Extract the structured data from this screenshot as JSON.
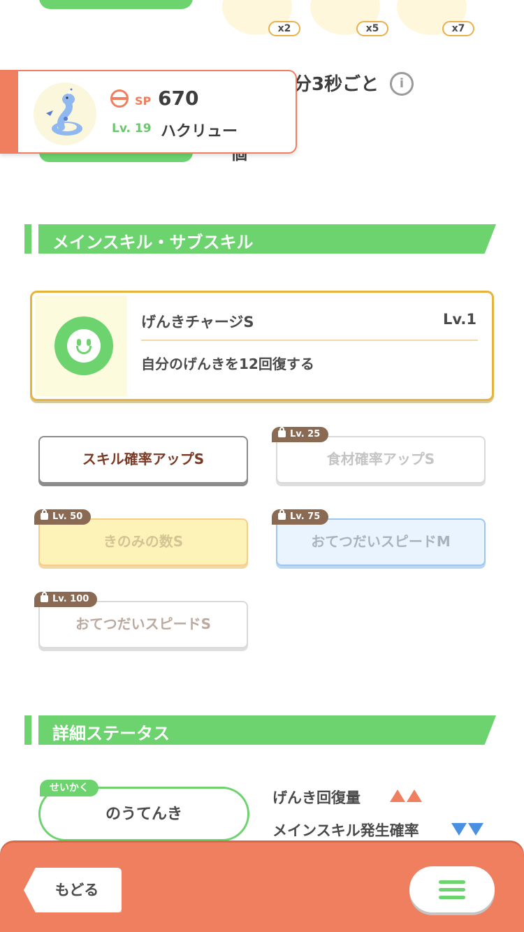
{
  "top": {
    "quantities": [
      "x2",
      "x5",
      "x7"
    ],
    "interval_text": "分3秒ごと",
    "partial_text": "個"
  },
  "pokemon": {
    "sp_label": "SP",
    "sp_value": "670",
    "level": "Lv. 19",
    "name": "ハクリュー"
  },
  "skills_section": {
    "title": "メインスキル・サブスキル",
    "main_skill": {
      "name": "げんきチャージS",
      "level": "Lv.1",
      "description": "自分のげんきを12回復する"
    },
    "sub_skills": [
      {
        "label": "スキル確率アップS",
        "lock": ""
      },
      {
        "label": "食材確率アップS",
        "lock": "Lv. 25"
      },
      {
        "label": "きのみの数S",
        "lock": "Lv. 50"
      },
      {
        "label": "おてつだいスピードM",
        "lock": "Lv. 75"
      },
      {
        "label": "おてつだいスピードS",
        "lock": "Lv. 100"
      }
    ]
  },
  "status_section": {
    "title": "詳細ステータス",
    "nature_tag": "せいかく",
    "nature": "のうてんき",
    "up_stat": "げんき回復量",
    "down_stat": "メインスキル発生確率",
    "colors": {
      "up": "#ef7f5e",
      "down": "#4a90e2"
    }
  },
  "bottom": {
    "back_label": "もどる",
    "menu_icon": "hamburger-menu-icon"
  }
}
